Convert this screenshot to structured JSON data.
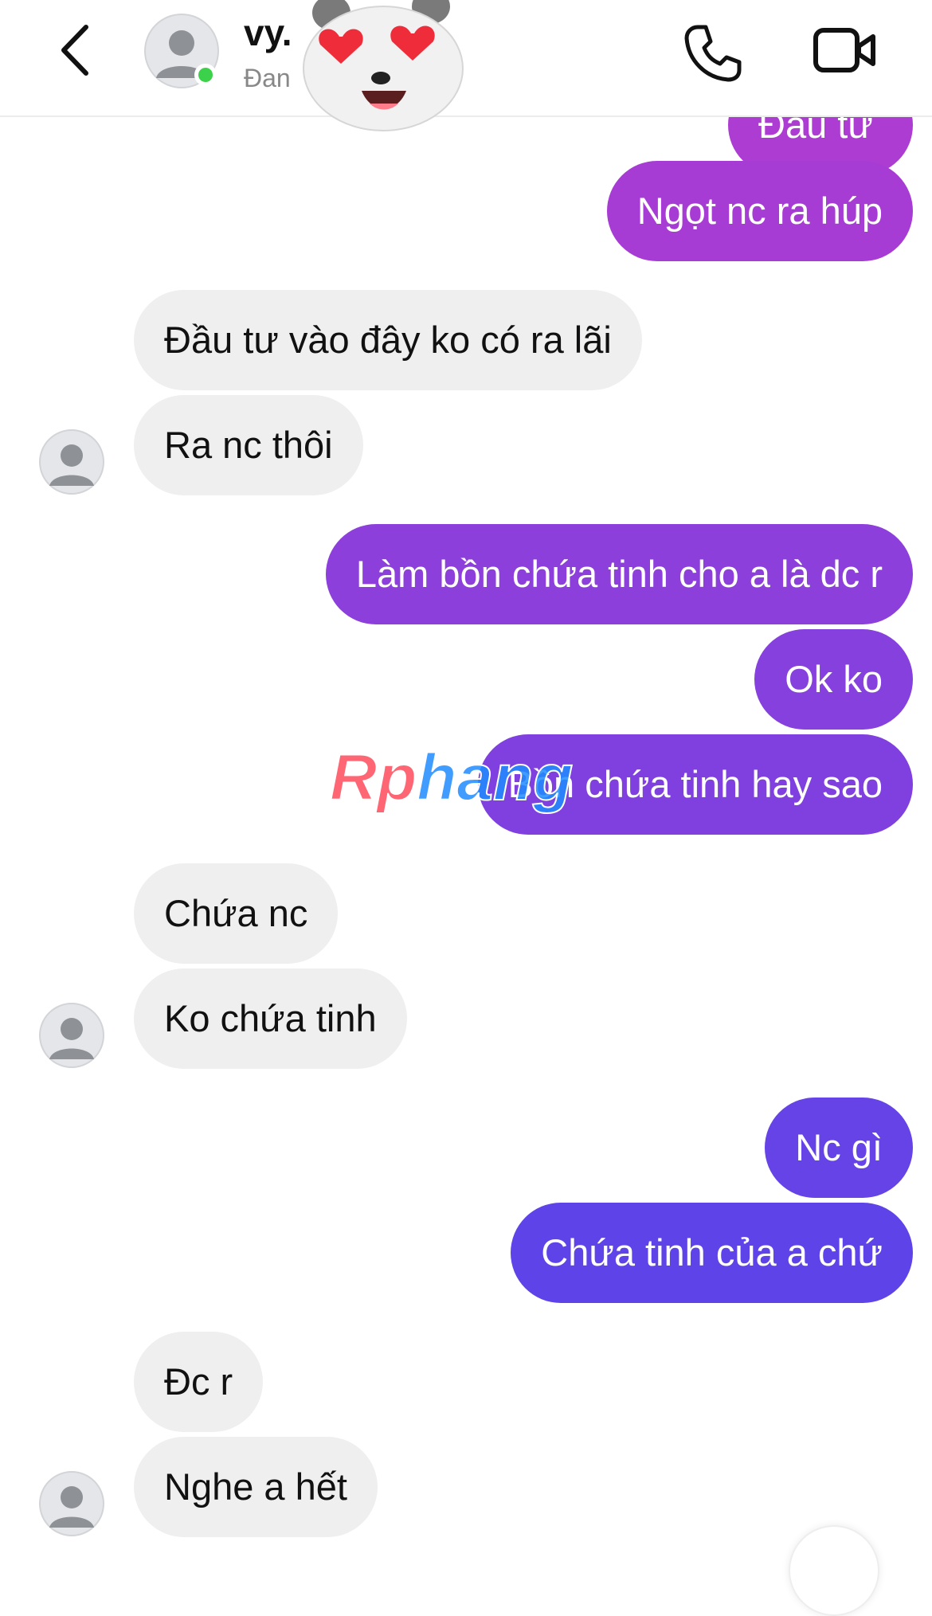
{
  "header": {
    "contact_name": "vy.",
    "contact_status": "Đan",
    "back_icon": "chevron-left-icon",
    "call_icon": "phone-icon",
    "video_icon": "video-camera-icon"
  },
  "messages": [
    {
      "dir": "out",
      "text": "Đầu tư"
    },
    {
      "dir": "out",
      "text": "Ngọt nc ra húp"
    },
    {
      "dir": "in",
      "text": "Đầu tư vào đây ko có ra lãi"
    },
    {
      "dir": "in",
      "text": "Ra nc thôi"
    },
    {
      "dir": "out",
      "text": "Làm bồn chứa tinh cho a là dc r"
    },
    {
      "dir": "out",
      "text": "Ok ko"
    },
    {
      "dir": "out",
      "text": "Bồn chứa tinh hay sao"
    },
    {
      "dir": "in",
      "text": "Chứa nc"
    },
    {
      "dir": "in",
      "text": "Ko chứa tinh"
    },
    {
      "dir": "out",
      "text": "Nc gì"
    },
    {
      "dir": "out",
      "text": "Chứa tinh của a chứ"
    },
    {
      "dir": "in",
      "text": "Đc r"
    },
    {
      "dir": "in",
      "text": "Nghe a hết"
    }
  ],
  "watermark": "Rphang",
  "colors": {
    "outgoing_top": "#b23bd1",
    "outgoing_bottom": "#5e44e8",
    "incoming": "#efeff0",
    "online": "#3bd14a"
  }
}
